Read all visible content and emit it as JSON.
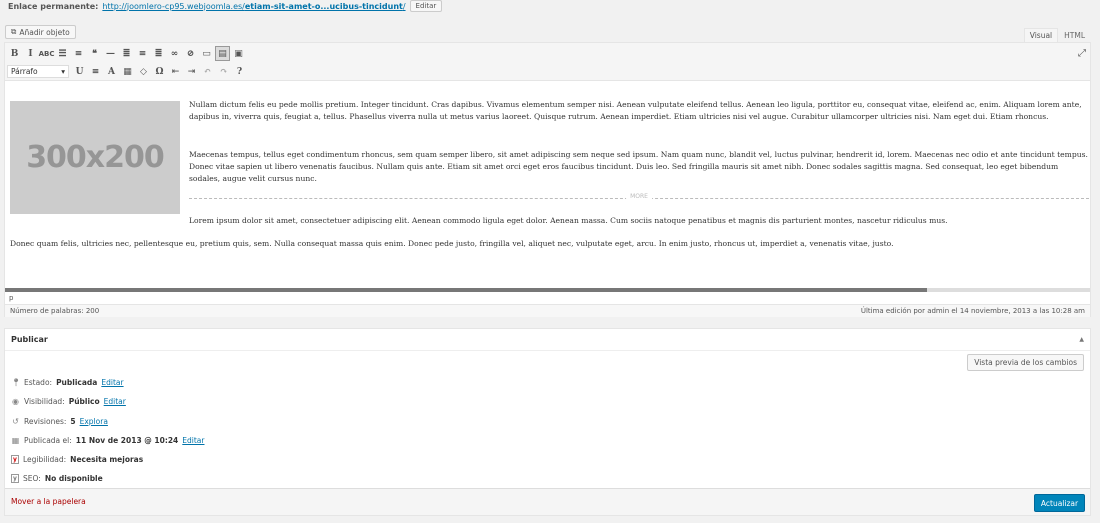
{
  "permalink": {
    "label": "Enlace permanente:",
    "url_prefix": "http://joomlero-cp95.webjoomla.es/",
    "url_slug": "etiam-sit-amet-o...ucibus-tincidunt",
    "url_suffix": "/",
    "edit_label": "Editar"
  },
  "media": {
    "add_label": "Añadir objeto"
  },
  "tabs": [
    {
      "label": "Visual",
      "active": true
    },
    {
      "label": "HTML",
      "active": false
    }
  ],
  "toolbar": {
    "row1": [
      {
        "icon": "bold-icon",
        "glyph": "B"
      },
      {
        "icon": "italic-icon",
        "glyph": "I"
      },
      {
        "icon": "strikethrough-icon",
        "glyph": "ABC"
      },
      {
        "icon": "bullet-list-icon",
        "glyph": "☰"
      },
      {
        "icon": "numbered-list-icon",
        "glyph": "≡"
      },
      {
        "icon": "blockquote-icon",
        "glyph": "❝"
      },
      {
        "icon": "horizontal-line-icon",
        "glyph": "—"
      },
      {
        "icon": "align-left-icon",
        "glyph": "≣"
      },
      {
        "icon": "align-center-icon",
        "glyph": "≡"
      },
      {
        "icon": "align-right-icon",
        "glyph": "≣"
      },
      {
        "icon": "insert-link-icon",
        "glyph": "∞"
      },
      {
        "icon": "unlink-icon",
        "glyph": "⊘"
      },
      {
        "icon": "read-more-icon",
        "glyph": "▭"
      },
      {
        "icon": "toolbar-toggle-icon",
        "glyph": "▤"
      },
      {
        "icon": "briefcase-icon",
        "glyph": "▣"
      }
    ],
    "row2": [
      {
        "icon": "underline-icon",
        "glyph": "U"
      },
      {
        "icon": "justify-icon",
        "glyph": "≡"
      },
      {
        "icon": "text-color-icon",
        "glyph": "A"
      },
      {
        "icon": "paste-text-icon",
        "glyph": "▦"
      },
      {
        "icon": "clear-formatting-icon",
        "glyph": "◇"
      },
      {
        "icon": "special-char-icon",
        "glyph": "Ω"
      },
      {
        "icon": "outdent-icon",
        "glyph": "⇤"
      },
      {
        "icon": "indent-icon",
        "glyph": "⇥"
      },
      {
        "icon": "undo-icon",
        "glyph": "↶"
      },
      {
        "icon": "redo-icon",
        "glyph": "↷"
      },
      {
        "icon": "help-icon",
        "glyph": "?"
      }
    ],
    "format_value": "Párrafo"
  },
  "image_placeholder": {
    "text": "300x200"
  },
  "content": {
    "p1": "Nullam dictum felis eu pede mollis pretium. Integer tincidunt. Cras dapibus. Vivamus elementum semper nisi. Aenean vulputate eleifend tellus. Aenean leo ligula, porttitor eu, consequat vitae, eleifend ac, enim. Aliquam lorem ante, dapibus in, viverra quis, feugiat a, tellus. Phasellus viverra nulla ut metus varius laoreet. Quisque rutrum. Aenean imperdiet. Etiam ultricies nisi vel augue. Curabitur ullamcorper ultricies nisi. Nam eget dui. Etiam rhoncus.",
    "p2": "Maecenas tempus, tellus eget condimentum rhoncus, sem quam semper libero, sit amet adipiscing sem neque sed ipsum. Nam quam nunc, blandit vel, luctus pulvinar, hendrerit id, lorem. Maecenas nec odio et ante tincidunt tempus. Donec vitae sapien ut libero venenatis faucibus. Nullam quis ante. Etiam sit amet orci eget eros faucibus tincidunt. Duis leo. Sed fringilla mauris sit amet nibh. Donec sodales sagittis magna. Sed consequat, leo eget bibendum sodales, augue velit cursus nunc.",
    "more_label": "MORE",
    "p3": "Lorem ipsum dolor sit amet, consectetuer adipiscing elit. Aenean commodo ligula eget dolor. Aenean massa. Cum sociis natoque penatibus et magnis dis parturient montes, nascetur ridiculus mus.",
    "p4": "Donec quam felis, ultricies nec, pellentesque eu, pretium quis, sem. Nulla consequat massa quis enim. Donec pede justo, fringilla vel, aliquet nec, vulputate eget, arcu. In enim justo, rhoncus ut, imperdiet a, venenatis vitae, justo."
  },
  "editor_status": {
    "path": "p",
    "word_count": "Número de palabras: 200",
    "last_edit": "Última edición por admin el 14 noviembre, 2013 a las 10:28 am"
  },
  "publish": {
    "title": "Publicar",
    "preview_label": "Vista previa de los cambios",
    "status_label": "Estado:",
    "status_value": "Publicada",
    "status_edit": "Editar",
    "visibility_label": "Visibilidad:",
    "visibility_value": "Público",
    "visibility_edit": "Editar",
    "revisions_label": "Revisiones:",
    "revisions_value": "5",
    "revisions_link": "Explora",
    "published_label": "Publicada el:",
    "published_value": "11 Nov de 2013 @ 10:24",
    "published_edit": "Editar",
    "readability_label": "Legibilidad:",
    "readability_value": "Necesita mejoras",
    "seo_label": "SEO:",
    "seo_value": "No disponible",
    "trash_label": "Mover a la papelera",
    "update_label": "Actualizar"
  },
  "colors": {
    "link": "#0073aa",
    "update_button": "#0085ba",
    "trash": "#a00000",
    "readability_bad": "#cc0000"
  }
}
